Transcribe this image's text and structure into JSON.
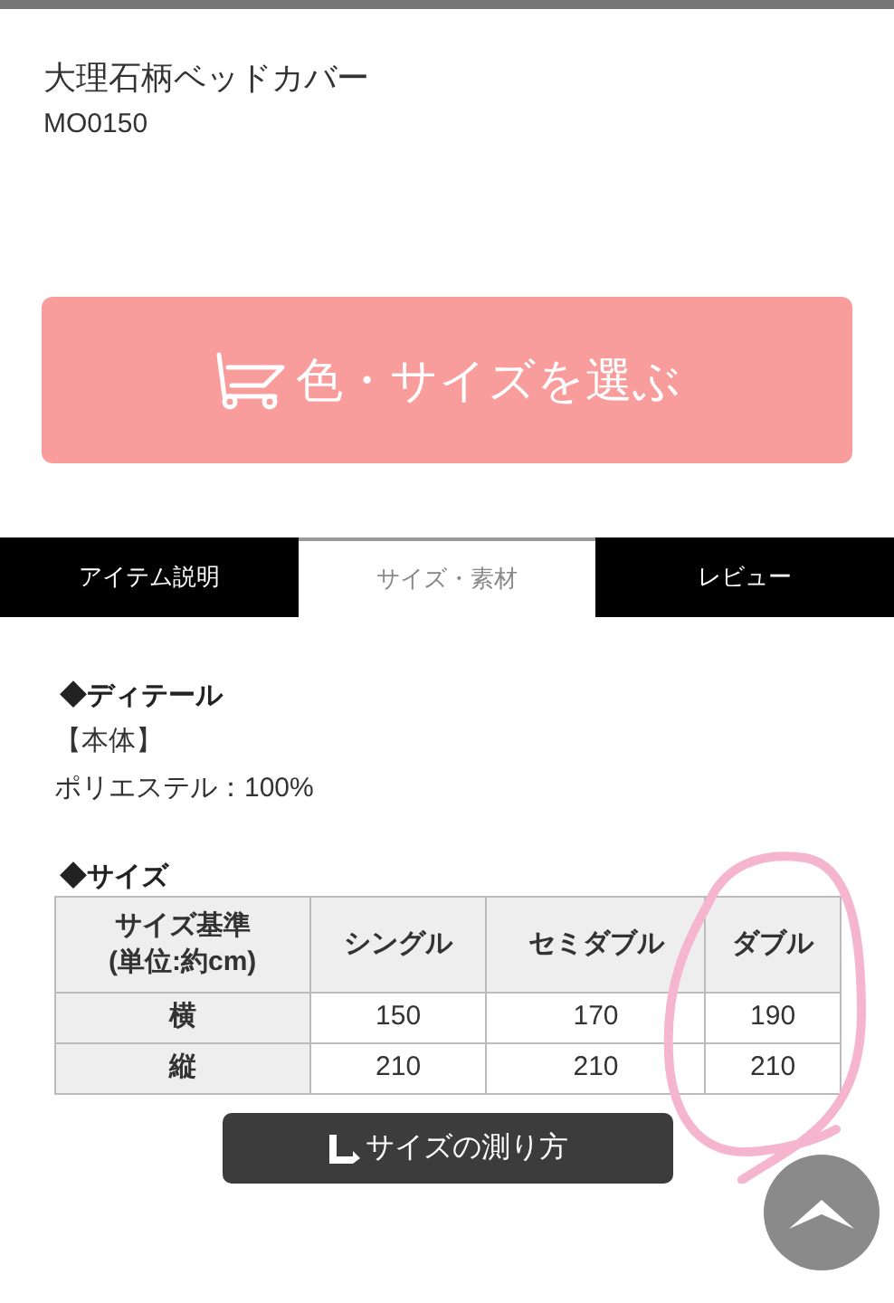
{
  "product": {
    "title": "大理石柄ベッドカバー",
    "code": "MO0150"
  },
  "select_button": {
    "label": "色・サイズを選ぶ"
  },
  "tabs": [
    {
      "label": "アイテム説明",
      "selected": false
    },
    {
      "label": "サイズ・素材",
      "selected": true
    },
    {
      "label": "レビュー",
      "selected": false
    }
  ],
  "detail": {
    "heading": "◆ディテール",
    "lines": [
      "【本体】",
      "ポリエステル：100%"
    ]
  },
  "size": {
    "heading": "◆サイズ",
    "table": {
      "columns": [
        "サイズ基準\n(単位:約cm)",
        "シングル",
        "セミダブル",
        "ダブル"
      ],
      "rows": [
        [
          "横",
          "150",
          "170",
          "190"
        ],
        [
          "縦",
          "210",
          "210",
          "210"
        ]
      ]
    }
  },
  "measure_button": {
    "label": "サイズの測り方"
  }
}
